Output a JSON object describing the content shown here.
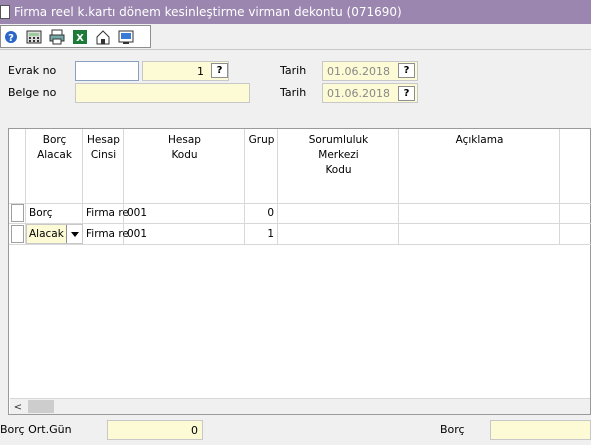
{
  "window": {
    "title": "Firma reel k.kartı dönem kesinleştirme virman dekontu (071690)"
  },
  "toolbar": {
    "icons": [
      "help-icon",
      "calculator-icon",
      "print-icon",
      "excel-icon",
      "save-icon",
      "preview-icon"
    ]
  },
  "form": {
    "evrak_label": "Evrak no",
    "evrak_seri": "",
    "evrak_sira": "1",
    "belge_label": "Belge no",
    "belge_value": "",
    "tarih1_label": "Tarih",
    "tarih1_value": "01.06.2018",
    "tarih2_label": "Tarih",
    "tarih2_value": "01.06.2018",
    "lookup_label": "?"
  },
  "grid": {
    "columns": [
      {
        "key": "borc_alacak",
        "lines": [
          "Borç",
          "Alacak"
        ]
      },
      {
        "key": "hesap_cinsi",
        "lines": [
          "Hesap",
          "Cinsi"
        ]
      },
      {
        "key": "hesap_kodu",
        "lines": [
          "Hesap",
          "Kodu"
        ]
      },
      {
        "key": "grup",
        "lines": [
          "Grup"
        ]
      },
      {
        "key": "sorumluluk",
        "lines": [
          "Sorumluluk",
          "Merkezi",
          "Kodu"
        ]
      },
      {
        "key": "aciklama",
        "lines": [
          "Açıklama"
        ]
      }
    ],
    "rows": [
      {
        "borc_alacak": "Borç",
        "hesap_cinsi": "Firma re",
        "hesap_kodu": "001",
        "grup": "0",
        "sorumluluk": "",
        "aciklama": ""
      },
      {
        "borc_alacak": "Alacak",
        "hesap_cinsi": "Firma re",
        "hesap_kodu": "001",
        "grup": "1",
        "sorumluluk": "",
        "aciklama": ""
      }
    ],
    "scroll_left": "<"
  },
  "footer": {
    "borc_ort_gun_label": "Borç Ort.Gün",
    "borc_ort_gun_value": "0",
    "borc_label": "Borç",
    "borc_value": ""
  }
}
